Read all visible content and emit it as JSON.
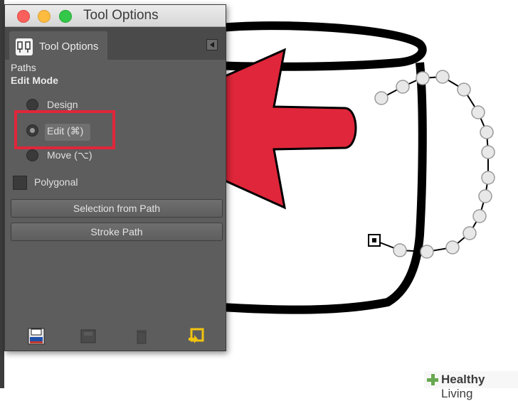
{
  "window": {
    "title": "Tool Options"
  },
  "tab": {
    "label": "Tool Options"
  },
  "panel": {
    "section_label": "Paths",
    "edit_mode_label": "Edit Mode",
    "edit_mode_options": [
      {
        "label": "Design",
        "selected": false
      },
      {
        "label": "Edit (⌘)",
        "selected": true
      },
      {
        "label": "Move (⌥)",
        "selected": false
      }
    ],
    "polygonal_label": "Polygonal",
    "polygonal_checked": false,
    "selection_from_path_label": "Selection from Path",
    "stroke_path_label": "Stroke Path"
  },
  "bottom_icons": [
    "save-options-icon",
    "restore-options-icon",
    "delete-options-icon",
    "reset-options-icon"
  ],
  "annotation": {
    "arrow_color": "#e0263a",
    "box_color": "#e0263a"
  },
  "watermark": {
    "brand": "Healthy",
    "suffix": "Living"
  }
}
